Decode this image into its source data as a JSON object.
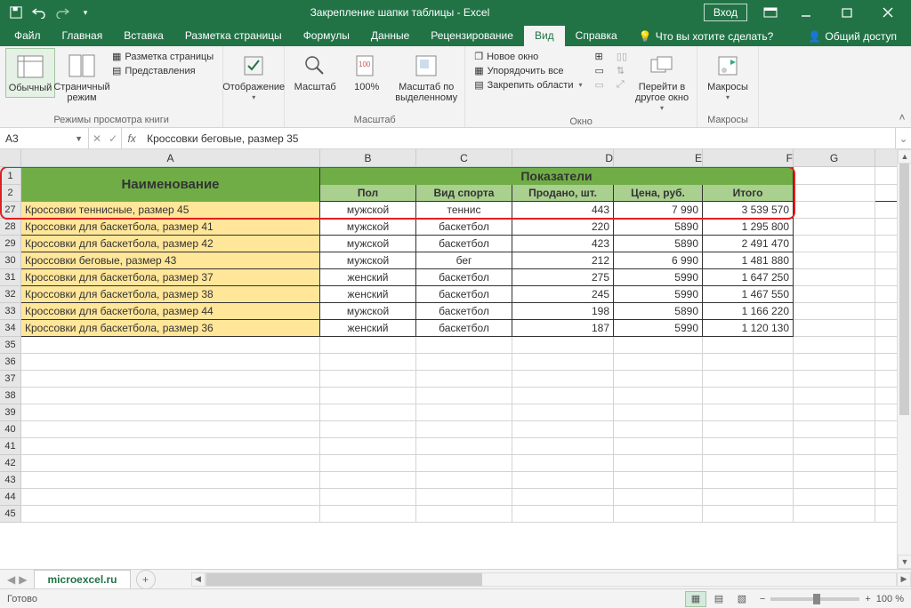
{
  "titlebar": {
    "title": "Закрепление шапки таблицы  -  Excel",
    "login": "Вход"
  },
  "tabs": {
    "file": "Файл",
    "home": "Главная",
    "insert": "Вставка",
    "pagelayout": "Разметка страницы",
    "formulas": "Формулы",
    "data": "Данные",
    "review": "Рецензирование",
    "view": "Вид",
    "help": "Справка",
    "tellme": "Что вы хотите сделать?",
    "share": "Общий доступ"
  },
  "ribbon": {
    "group_views": "Режимы просмотра книги",
    "normal": "Обычный",
    "pagebreak": "Страничный режим",
    "pagelayout_btn": "Разметка страницы",
    "customviews": "Представления",
    "show_btn": "Отображение",
    "zoom_group": "Масштаб",
    "zoom": "Масштаб",
    "zoom100": "100%",
    "zoom_selection": "Масштаб по выделенному",
    "window_group": "Окно",
    "new_window": "Новое окно",
    "arrange": "Упорядочить все",
    "freeze": "Закрепить области",
    "switch": "Перейти в другое окно",
    "macros_group": "Макросы",
    "macros": "Макросы"
  },
  "namebox": "A3",
  "formula": "Кроссовки беговые, размер 35",
  "columns": [
    "A",
    "B",
    "C",
    "D",
    "E",
    "F",
    "G"
  ],
  "header": {
    "name": "Наименование",
    "metrics": "Показатели",
    "sex": "Пол",
    "sport": "Вид спорта",
    "sold": "Продано, шт.",
    "price": "Цена, руб.",
    "total": "Итого"
  },
  "rows": [
    {
      "n": 27,
      "a": "Кроссовки теннисные, размер 45",
      "b": "мужской",
      "c": "теннис",
      "d": "443",
      "e": "7 990",
      "f": "3 539 570"
    },
    {
      "n": 28,
      "a": "Кроссовки для баскетбола, размер 41",
      "b": "мужской",
      "c": "баскетбол",
      "d": "220",
      "e": "5890",
      "f": "1 295 800"
    },
    {
      "n": 29,
      "a": "Кроссовки для баскетбола, размер 42",
      "b": "мужской",
      "c": "баскетбол",
      "d": "423",
      "e": "5890",
      "f": "2 491 470"
    },
    {
      "n": 30,
      "a": "Кроссовки беговые, размер 43",
      "b": "мужской",
      "c": "бег",
      "d": "212",
      "e": "6 990",
      "f": "1 481 880"
    },
    {
      "n": 31,
      "a": "Кроссовки для баскетбола, размер 37",
      "b": "женский",
      "c": "баскетбол",
      "d": "275",
      "e": "5990",
      "f": "1 647 250"
    },
    {
      "n": 32,
      "a": "Кроссовки для баскетбола, размер 38",
      "b": "женский",
      "c": "баскетбол",
      "d": "245",
      "e": "5990",
      "f": "1 467 550"
    },
    {
      "n": 33,
      "a": "Кроссовки для баскетбола, размер 44",
      "b": "мужской",
      "c": "баскетбол",
      "d": "198",
      "e": "5890",
      "f": "1 166 220"
    },
    {
      "n": 34,
      "a": "Кроссовки для баскетбола, размер 36",
      "b": "женский",
      "c": "баскетбол",
      "d": "187",
      "e": "5990",
      "f": "1 120 130"
    }
  ],
  "empty_rows": [
    35,
    36,
    37,
    38,
    39,
    40,
    41,
    42,
    43,
    44,
    45
  ],
  "sheet_tab": "microexcel.ru",
  "status": "Готово",
  "zoom_pct": "100 %"
}
